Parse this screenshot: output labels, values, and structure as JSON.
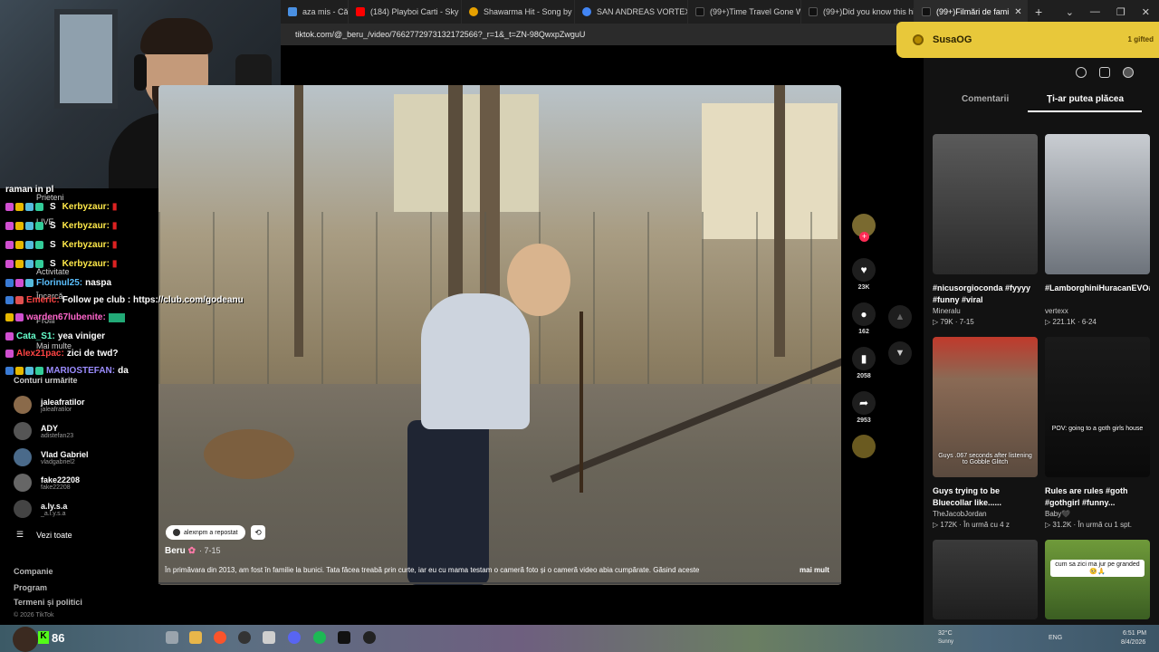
{
  "browser": {
    "tabs": [
      {
        "label": "aza mis - Căutare",
        "color": "#4a90e2"
      },
      {
        "label": "(184) Playboi Carti - Sky [Offi",
        "color": "#ff0000"
      },
      {
        "label": "Shawarma Hit - Song by use",
        "color": "#e6a000"
      },
      {
        "label": "SAN ANDREAS VORTEX - Că",
        "color": "#4285f4"
      },
      {
        "label": "(99+)Time Travel Gone Wron",
        "color": "#111111"
      },
      {
        "label": "(99+)Did you know this hidd",
        "color": "#111111"
      },
      {
        "label": "(99+)Filmări de fami",
        "color": "#111111"
      }
    ],
    "new_tab": "+",
    "url": "tiktok.com/@_beru_/video/7662772973132172566?_r=1&_t=ZN-98QwxpZwguU",
    "window_controls": [
      "⌄",
      "—",
      "❐",
      "✕"
    ]
  },
  "toast": {
    "name": "SusaOG",
    "badge": "1 gifted"
  },
  "chat": [
    {
      "user": "",
      "msg": "raman in pl",
      "color": "#ffffff"
    },
    {
      "user": "Kerbyzaur:",
      "msg": "",
      "color": "#ffe94a"
    },
    {
      "user": "Kerbyzaur:",
      "msg": "",
      "color": "#ffe94a"
    },
    {
      "user": "Kerbyzaur:",
      "msg": "",
      "color": "#ffe94a"
    },
    {
      "user": "Kerbyzaur:",
      "msg": "",
      "color": "#ffe94a"
    },
    {
      "user": "Florinul25:",
      "msg": "naspa",
      "color": "#5bc0ff"
    },
    {
      "user": "Emeric:",
      "msg": "Follow pe club : https://club.com/godeanu",
      "color": "#ff4444"
    },
    {
      "user": "warden67lubenite:",
      "msg": "",
      "color": "#ff66cc"
    },
    {
      "user": "Cata_S1:",
      "msg": "yea viniger",
      "color": "#66ffcc"
    },
    {
      "user": "Alex21pac:",
      "msg": "zici de twd?",
      "color": "#ff4444"
    },
    {
      "user": "MARIOSTEFAN:",
      "msg": "da",
      "color": "#9b8cff"
    }
  ],
  "sidebar": {
    "labels": [
      "Prieteni",
      "LIVE",
      "Activitate",
      "Încarcă",
      "Profil",
      "Mai multe"
    ],
    "following_title": "Conturi urmărite",
    "following": [
      {
        "name": "jaleafratilor",
        "handle": "jaleafratilor"
      },
      {
        "name": "ADY",
        "handle": "adistefan23"
      },
      {
        "name": "Vlad Gabriel",
        "handle": "vladgabriel2"
      },
      {
        "name": "fake22208",
        "handle": "fake22208"
      },
      {
        "name": "a.ly.s.a",
        "handle": "_a.l.y.s.a"
      }
    ],
    "see_all": "Vezi toate",
    "footer": [
      "Companie",
      "Program",
      "Termeni și politici"
    ],
    "copyright": "© 2026 TikTok"
  },
  "video": {
    "repost": "alexnpm a repostat",
    "author": "Beru",
    "date": "· 7-15",
    "description": "În primăvara din 2013, am fost în familie la bunici. Tata făcea treabă prin curte, iar eu cu mama testam o cameră foto și o cameră video abia cumpărate. Găsind aceste",
    "more": "mai mult"
  },
  "actions": {
    "likes": "23K",
    "comments": "162",
    "saves": "2058",
    "shares": "2953"
  },
  "right_panel": {
    "tabs": [
      "Comentarii",
      "Ți-ar putea plăcea"
    ],
    "cards": [
      {
        "title": "#nicusorgioconda #fyyyy #funny #viral",
        "creator": "Mineralu",
        "stats": "▷ 79K · 7-15",
        "caption": "",
        "bg": "#3a3a3a"
      },
      {
        "title": "#LamborghiniHuracanEVO#Lamborghini#bar...",
        "creator": "vertexx",
        "stats": "▷ 221.1K · 6-24",
        "caption": "",
        "bg": "#8a8f96"
      },
      {
        "title": "Guys trying to be Bluecollar like......",
        "creator": "TheJacobJordan",
        "stats": "▷ 172K · În urmă cu 4 z",
        "caption": "Guys .067 seconds after listening to Gobble Glitch",
        "bg": "#6a5a4a"
      },
      {
        "title": "Rules are rules #goth #gothgirl #funny...",
        "creator": "Baby🖤",
        "stats": "▷ 31.2K · În urmă cu 1 spt.",
        "caption": "POV: going to a goth girls house",
        "bg": "#222222"
      },
      {
        "title": "",
        "creator": "",
        "stats": "",
        "caption": "",
        "bg": "#2e2e2e"
      },
      {
        "title": "",
        "creator": "",
        "stats": "",
        "caption": "cum sa zici ma jur pe granded 🥺🙏",
        "bg": "#4d7a2e"
      }
    ]
  },
  "taskbar": {
    "subs": "86",
    "weather": "32°C",
    "weather_desc": "Sunny",
    "lang": "ENG",
    "time": "6:51 PM",
    "date": "8/4/2026"
  }
}
